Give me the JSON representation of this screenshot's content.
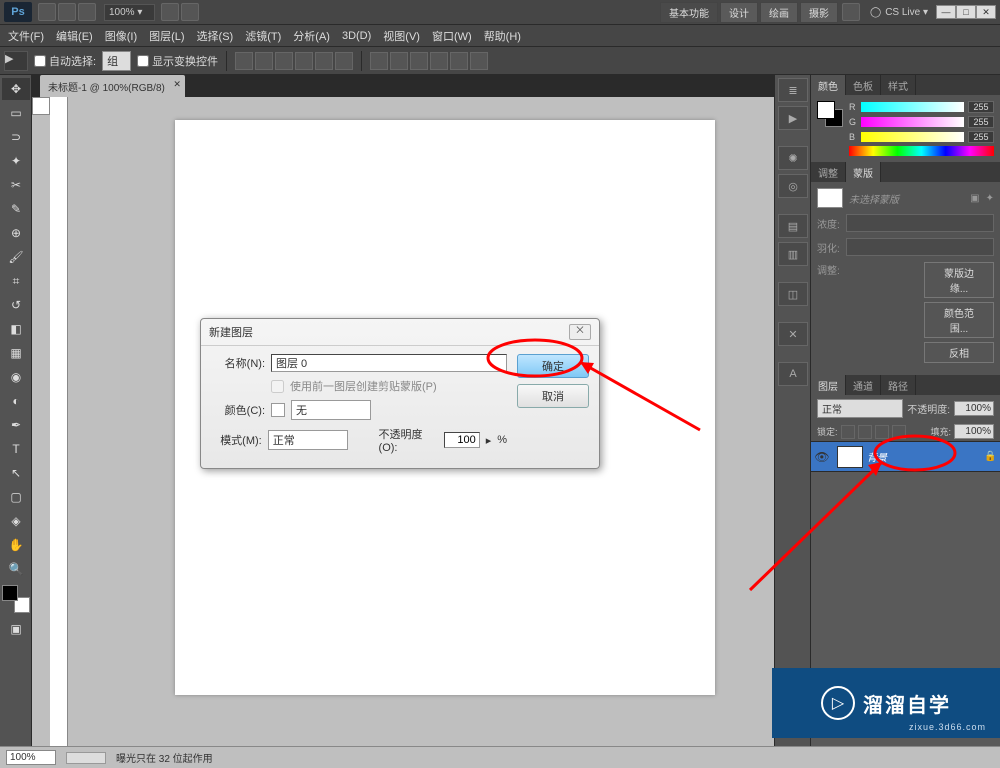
{
  "titlebar": {
    "logo": "Ps",
    "zoom": "100% ▾",
    "workspace_buttons": [
      "基本功能",
      "设计",
      "绘画",
      "摄影"
    ],
    "cslive": "CS Live ▾"
  },
  "menus": [
    "文件(F)",
    "编辑(E)",
    "图像(I)",
    "图层(L)",
    "选择(S)",
    "滤镜(T)",
    "分析(A)",
    "3D(D)",
    "视图(V)",
    "窗口(W)",
    "帮助(H)"
  ],
  "options": {
    "auto_select": "自动选择:",
    "group": "组",
    "show_transform": "显示变换控件"
  },
  "doc": {
    "tab": "未标题-1 @ 100%(RGB/8)"
  },
  "status": {
    "zoom": "100%",
    "info": "曝光只在 32 位起作用"
  },
  "color_panel": {
    "tabs": [
      "颜色",
      "色板",
      "样式"
    ],
    "r": "255",
    "g": "255",
    "b": "255",
    "labels": {
      "r": "R",
      "g": "G",
      "b": "B"
    }
  },
  "adjust_panel": {
    "tabs": [
      "调整",
      "蒙版"
    ],
    "mask_hint": "未选择蒙版",
    "density": "浓度:",
    "feather": "羽化:",
    "adjust": "调整:",
    "btn_edge": "蒙版边缘...",
    "btn_range": "颜色范围...",
    "btn_invert": "反相"
  },
  "layers_panel": {
    "tabs": [
      "图层",
      "通道",
      "路径"
    ],
    "blend": "正常",
    "opacity_lbl": "不透明度:",
    "opacity": "100%",
    "lock_lbl": "锁定:",
    "fill_lbl": "填充:",
    "fill": "100%",
    "layer_name": "背景"
  },
  "dialog": {
    "title": "新建图层",
    "name_lbl": "名称(N):",
    "name_val": "图层 0",
    "clip_lbl": "使用前一图层创建剪贴蒙版(P)",
    "color_lbl": "颜色(C):",
    "color_val": "无",
    "mode_lbl": "模式(M):",
    "mode_val": "正常",
    "opacity_lbl": "不透明度(O):",
    "opacity_val": "100",
    "opacity_pct": "%",
    "ok": "确定",
    "cancel": "取消"
  },
  "watermark": {
    "text": "溜溜自学",
    "url": "zixue.3d66.com"
  }
}
